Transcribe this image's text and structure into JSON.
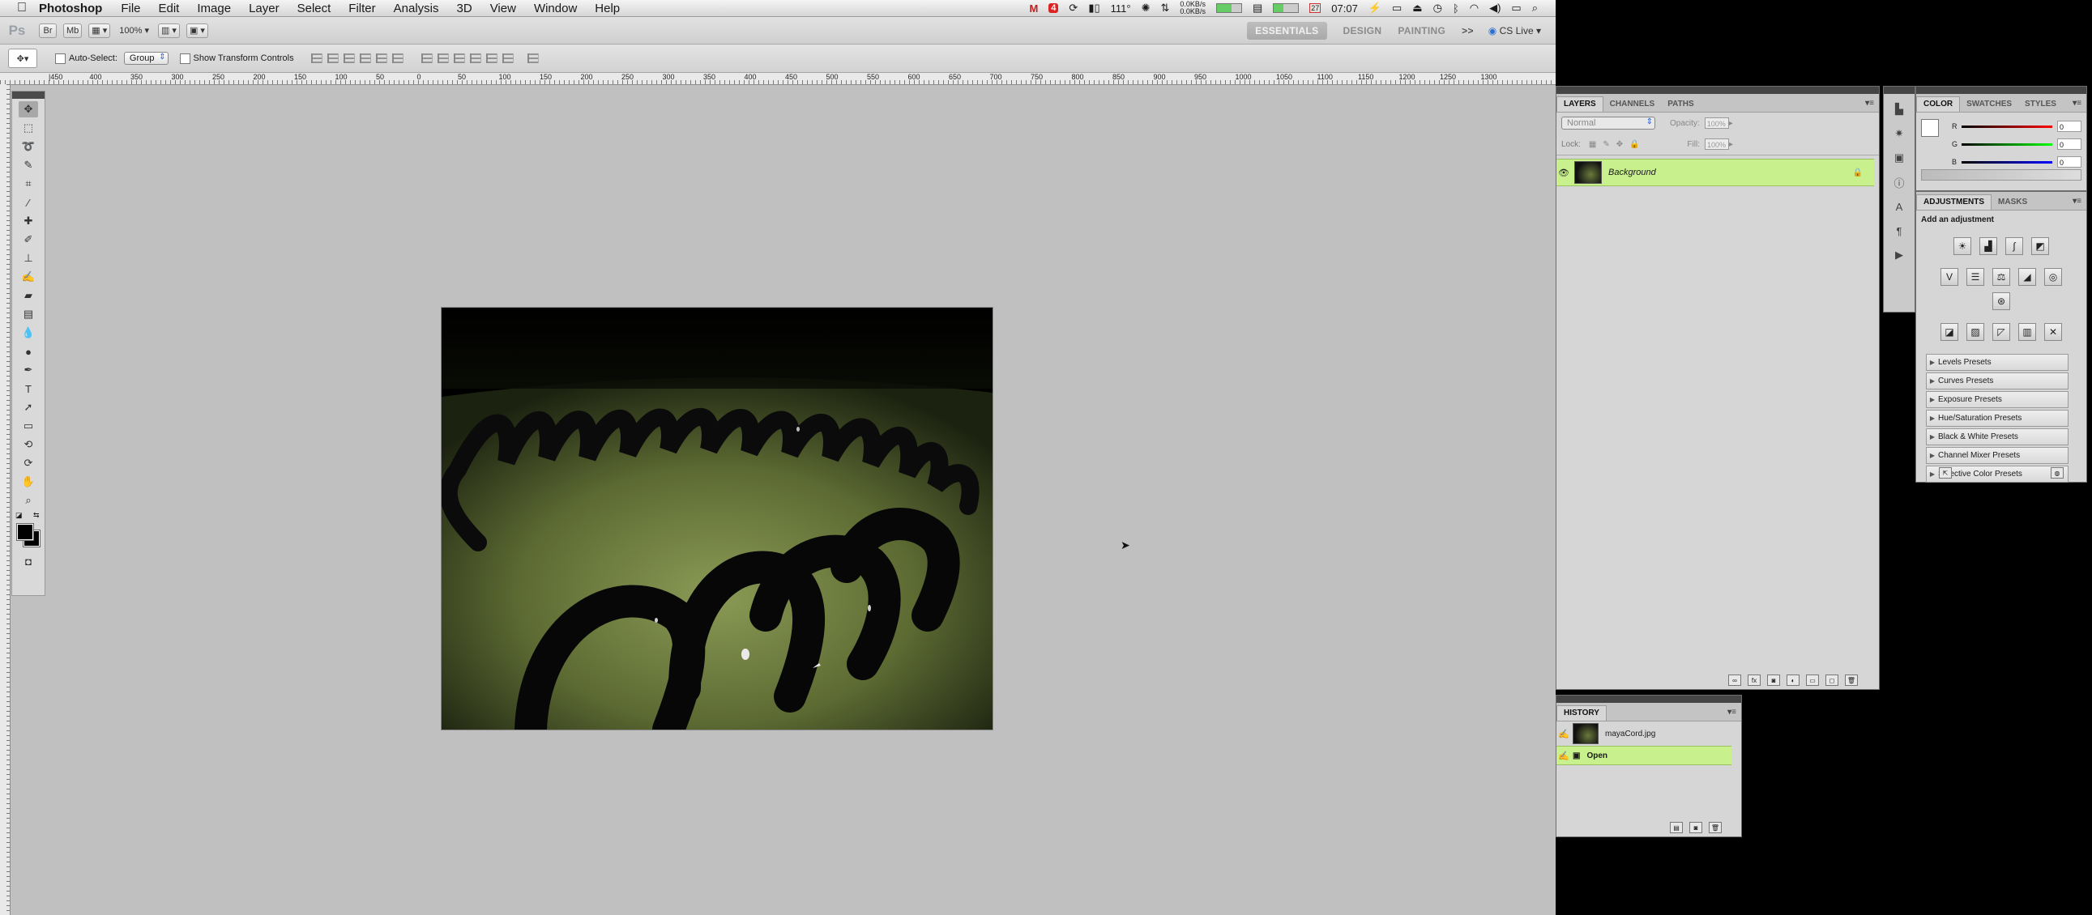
{
  "menubar": {
    "app_name": "Photoshop",
    "menus": [
      "File",
      "Edit",
      "Image",
      "Layer",
      "Select",
      "Filter",
      "Analysis",
      "3D",
      "View",
      "Window",
      "Help"
    ],
    "status": {
      "mail_badge": "4",
      "temperature": "111°",
      "net_up": "0.0KB/s",
      "net_down": "0.0KB/s",
      "calendar_day": "27",
      "time": "07:07"
    }
  },
  "appbar": {
    "logo": "Ps",
    "btn_br": "Br",
    "btn_mb": "Mb",
    "zoom": "100%",
    "workspaces": [
      "ESSENTIALS",
      "DESIGN",
      "PAINTING"
    ],
    "more": ">>",
    "cs_live": "CS Live"
  },
  "options": {
    "auto_select_label": "Auto-Select:",
    "auto_select_value": "Group",
    "transform_label": "Show Transform Controls"
  },
  "ruler": {
    "labels": [
      "|450",
      "400",
      "350",
      "300",
      "250",
      "200",
      "150",
      "100",
      "50",
      "0",
      "50",
      "100",
      "150",
      "200",
      "250",
      "300",
      "350",
      "400",
      "450",
      "500",
      "550",
      "600",
      "650",
      "700",
      "750",
      "800",
      "850",
      "900",
      "950",
      "1000",
      "1050",
      "1100",
      "1150",
      "1200",
      "1250",
      "1300"
    ]
  },
  "layers_panel": {
    "tabs": [
      "LAYERS",
      "CHANNELS",
      "PATHS"
    ],
    "blend_mode": "Normal",
    "opacity_label": "Opacity:",
    "opacity_value": "100%",
    "lock_label": "Lock:",
    "fill_label": "Fill:",
    "fill_value": "100%",
    "layers": [
      {
        "name": "Background",
        "locked": true
      }
    ]
  },
  "color_panel": {
    "tabs": [
      "COLOR",
      "SWATCHES",
      "STYLES"
    ],
    "channels": [
      {
        "label": "R",
        "value": "0"
      },
      {
        "label": "G",
        "value": "0"
      },
      {
        "label": "B",
        "value": "0"
      }
    ]
  },
  "adjustments_panel": {
    "tabs": [
      "ADJUSTMENTS",
      "MASKS"
    ],
    "heading": "Add an adjustment",
    "presets": [
      "Levels Presets",
      "Curves Presets",
      "Exposure Presets",
      "Hue/Saturation Presets",
      "Black & White Presets",
      "Channel Mixer Presets",
      "Selective Color Presets"
    ]
  },
  "history_panel": {
    "tab": "HISTORY",
    "snapshot": "mayaCord.jpg",
    "states": [
      "Open"
    ]
  },
  "colors": {
    "highlight": "#c8f08c",
    "canvas_bg": "#c0c0c0",
    "panel_bg": "#d6d6d6"
  }
}
